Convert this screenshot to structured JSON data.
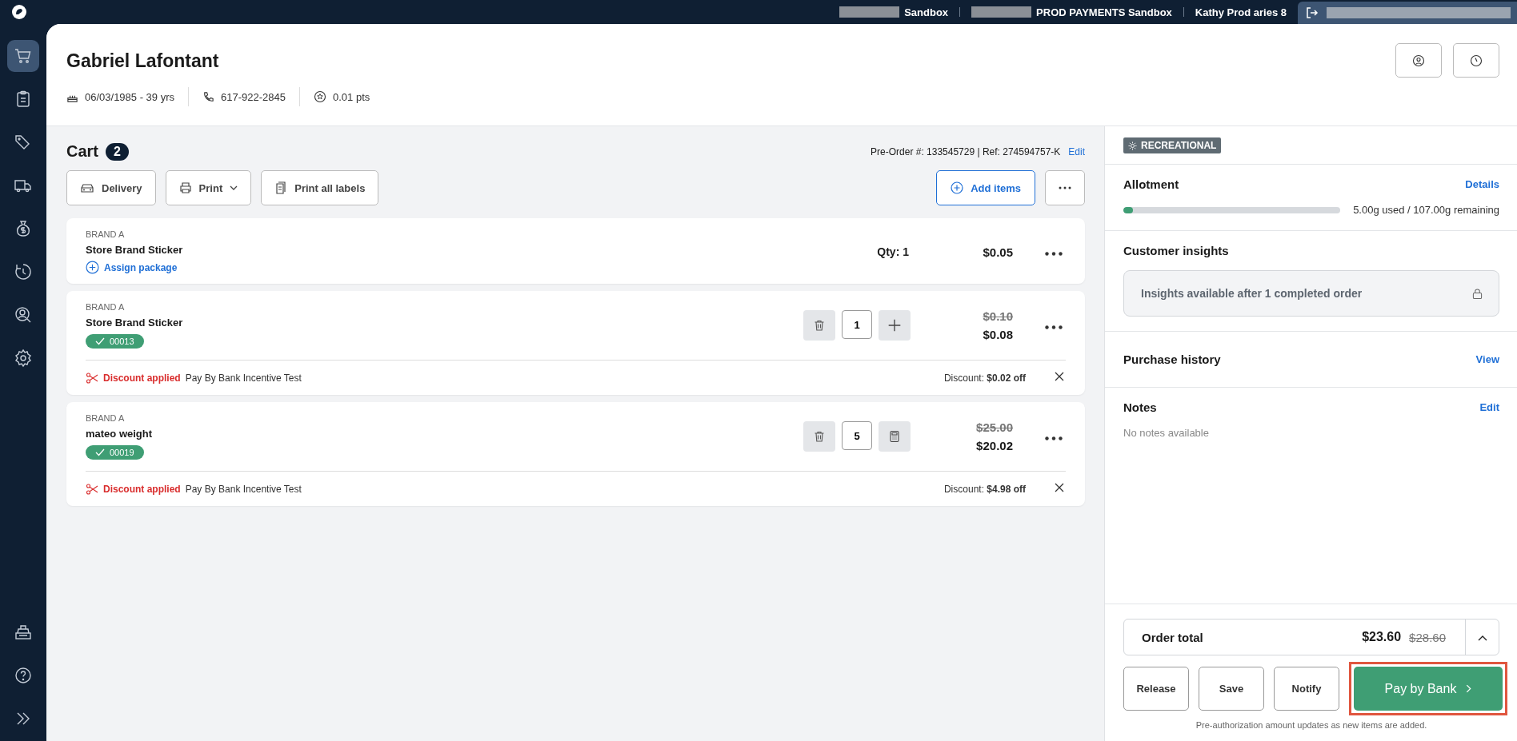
{
  "top_bar": {
    "accounts": [
      {
        "label": "Sandbox",
        "redacted": true
      },
      {
        "label": "PROD PAYMENTS Sandbox",
        "redacted": true
      },
      {
        "label": "Kathy Prod aries 8",
        "redacted": false
      }
    ]
  },
  "sidebar": {
    "items": [
      {
        "kind": "cart",
        "selected": true
      },
      {
        "kind": "clipboard",
        "selected": false
      },
      {
        "kind": "tags",
        "selected": false
      },
      {
        "kind": "truck",
        "selected": false
      },
      {
        "kind": "money",
        "selected": false
      },
      {
        "kind": "history",
        "selected": false
      },
      {
        "kind": "customer",
        "selected": false
      },
      {
        "kind": "settings",
        "selected": false
      }
    ],
    "bottom_items": [
      {
        "kind": "register"
      },
      {
        "kind": "help"
      },
      {
        "kind": "expand"
      }
    ]
  },
  "customer": {
    "name": "Gabriel Lafontant",
    "birth": "06/03/1985 - 39 yrs",
    "phone": "617-922-2845",
    "points": "0.01 pts"
  },
  "cart": {
    "title": "Cart",
    "count": "2",
    "order_ref": "Pre-Order #: 133545729 | Ref: 274594757-K",
    "edit": "Edit",
    "buttons": [
      {
        "label": "Delivery",
        "kind": "car"
      },
      {
        "label": "Print",
        "kind": "printer",
        "dropdown": true
      },
      {
        "label": "Print all labels",
        "kind": "labels",
        "dropdown": false
      }
    ],
    "add_items": "Add items",
    "items": [
      {
        "kind": "simple",
        "brand": "BRAND A",
        "name": "Store Brand Sticker",
        "assign": "Assign package",
        "qty": "Qty: 1",
        "price": "$0.05"
      },
      {
        "kind": "editable",
        "brand": "BRAND A",
        "name": "Store Brand Sticker",
        "tag": "00013",
        "quantity": "1",
        "qty_button": {
          "kind": "plus"
        },
        "original_price": "$0.10",
        "price": "$0.08",
        "discount": {
          "label": "Discount applied",
          "name": "Pay By Bank Incentive Test",
          "amount_label": "Discount:",
          "amount": "$0.02 off"
        }
      },
      {
        "kind": "editable",
        "brand": "BRAND A",
        "name": "mateo weight",
        "tag": "00019",
        "quantity": "5",
        "qty_button": {
          "kind": "calculator"
        },
        "original_price": "$25.00",
        "price": "$20.02",
        "discount": {
          "label": "Discount applied",
          "name": "Pay By Bank Incentive Test",
          "amount_label": "Discount:",
          "amount": "$4.98 off"
        }
      }
    ]
  },
  "panel": {
    "type_badge": "RECREATIONAL",
    "allotment": {
      "title": "Allotment",
      "link": "Details",
      "level": 0.045,
      "reading": "5.00g used / 107.00g remaining"
    },
    "insights": {
      "title": "Customer insights",
      "message": "Insights available after 1 completed order"
    },
    "purchase_history": {
      "title": "Purchase history",
      "link": "View"
    },
    "notes": {
      "title": "Notes",
      "link": "Edit",
      "empty": "No notes available"
    },
    "order_total": {
      "label": "Order total",
      "total": "$23.60",
      "original": "$28.60"
    },
    "actions": [
      "Release",
      "Save",
      "Notify"
    ],
    "primary": "Pay by Bank",
    "note": "Pre-authorization amount updates as new items are added."
  }
}
